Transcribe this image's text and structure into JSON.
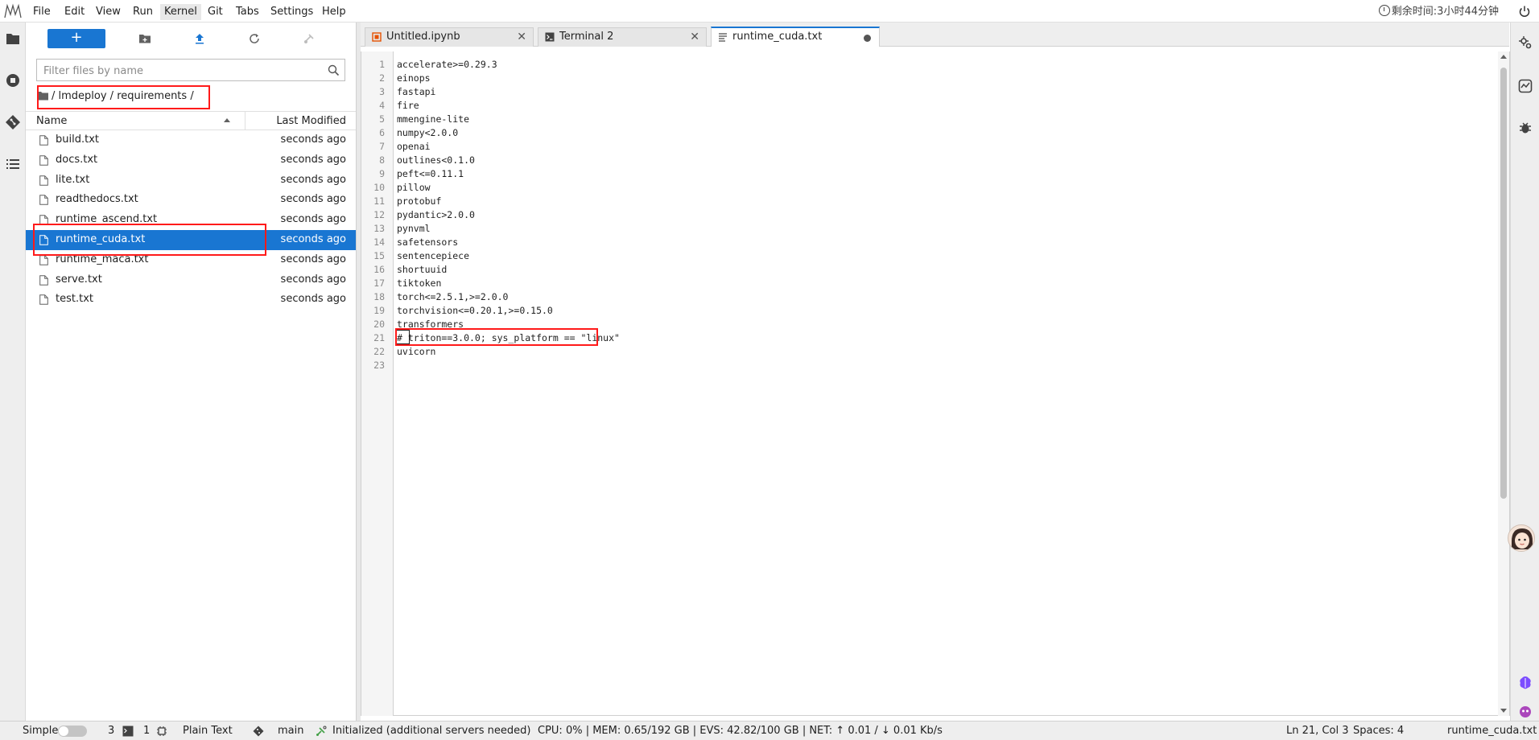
{
  "menu": {
    "items": [
      "File",
      "Edit",
      "View",
      "Run",
      "Kernel",
      "Git",
      "Tabs",
      "Settings",
      "Help"
    ],
    "active": "Kernel"
  },
  "timer": {
    "text": "剩余时间:3小时44分钟"
  },
  "filebrowser": {
    "new_label": "+",
    "search_placeholder": "Filter files by name",
    "breadcrumb": "/ lmdeploy / requirements /",
    "headers": {
      "name": "Name",
      "modified": "Last Modified"
    },
    "files": [
      {
        "name": "build.txt",
        "modified": "seconds ago",
        "selected": false
      },
      {
        "name": "docs.txt",
        "modified": "seconds ago",
        "selected": false
      },
      {
        "name": "lite.txt",
        "modified": "seconds ago",
        "selected": false
      },
      {
        "name": "readthedocs.txt",
        "modified": "seconds ago",
        "selected": false
      },
      {
        "name": "runtime_ascend.txt",
        "modified": "seconds ago",
        "selected": false
      },
      {
        "name": "runtime_cuda.txt",
        "modified": "seconds ago",
        "selected": true
      },
      {
        "name": "runtime_maca.txt",
        "modified": "seconds ago",
        "selected": false
      },
      {
        "name": "serve.txt",
        "modified": "seconds ago",
        "selected": false
      },
      {
        "name": "test.txt",
        "modified": "seconds ago",
        "selected": false
      }
    ]
  },
  "tabs": [
    {
      "label": "Untitled.ipynb",
      "icon": "notebook-icon",
      "active": false
    },
    {
      "label": "Terminal 2",
      "icon": "terminal-icon",
      "active": false
    },
    {
      "label": "runtime_cuda.txt",
      "icon": "text-file-icon",
      "active": true,
      "dirty": true
    }
  ],
  "editor": {
    "lines": [
      "accelerate>=0.29.3",
      "einops",
      "fastapi",
      "fire",
      "mmengine-lite",
      "numpy<2.0.0",
      "openai",
      "outlines<0.1.0",
      "peft<=0.11.1",
      "pillow",
      "protobuf",
      "pydantic>2.0.0",
      "pynvml",
      "safetensors",
      "sentencepiece",
      "shortuuid",
      "tiktoken",
      "torch<=2.5.1,>=2.0.0",
      "torchvision<=0.20.1,>=0.15.0",
      "transformers",
      "# triton==3.0.0; sys_platform == \"linux\"",
      "uvicorn",
      ""
    ],
    "cursor_line": 21
  },
  "statusbar": {
    "mode_label": "Simple",
    "kernels_count": "3",
    "terminals_count": "1",
    "file_type": "Plain Text",
    "branch": "main",
    "lsp_status": "Initialized (additional servers needed)",
    "resources": "CPU:  0%  |  MEM:  0.65/192  GB  |  EVS:  42.82/100  GB  |  NET:  ↑  0.01  /  ↓  0.01  Kb/s",
    "cursor_pos": "Ln 21, Col 3",
    "spaces": "Spaces: 4",
    "filename": "runtime_cuda.txt"
  },
  "colors": {
    "accent": "#1976d2",
    "annotation": "#ff1a1a"
  }
}
